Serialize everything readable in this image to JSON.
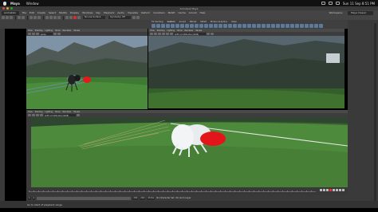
{
  "mac_menu": {
    "app_name": "Maya",
    "window": "Window",
    "clock": "Sun 11 Sep 8:51 PM"
  },
  "window_title": "Autodesk Maya",
  "menubar": {
    "mode": "Animation",
    "items": [
      "File",
      "Edit",
      "Create",
      "Select",
      "Modify",
      "Display",
      "Windows",
      "Key",
      "Playback",
      "Audio",
      "Visualize",
      "Deform",
      "Constrain",
      "MASH",
      "Cache",
      "Arnold",
      "Help"
    ],
    "workspace_label": "Workspace:",
    "workspace_value": "Maya Classic"
  },
  "statusline": {
    "no_live_surface": "No Live Surface",
    "symmetry": "Symmetry: Off"
  },
  "shelf": {
    "tabs": [
      "FX Caching",
      "Custom",
      "Arnold",
      "Bifrost",
      "MASH",
      "Motion Graphics",
      "XGen"
    ],
    "active_tab": "Custom"
  },
  "panel_top_left": {
    "menus": [
      "View",
      "Shading",
      "Lighting",
      "Show",
      "Renderer",
      "Panels"
    ],
    "field": "persp"
  },
  "panel_top_right": {
    "menus": [
      "View",
      "Shading",
      "Lighting",
      "Show",
      "Renderer",
      "Panels"
    ],
    "field": "ACES 1.0 SDR-video (sRGB)"
  },
  "panel_bottom": {
    "menus": [
      "View",
      "Shading",
      "Lighting",
      "Show",
      "Renderer",
      "Panels"
    ],
    "field": "ACES 1.0 SDR-video (sRGB)"
  },
  "timeline": {
    "range_start": "1",
    "playback_start": "1",
    "playback_end": "240",
    "range_end": "240",
    "fps": "24 fps",
    "no_character_set": "No Character Set",
    "no_anim_layer": "No Anim Layer"
  },
  "help_line": "Go to start of playback range"
}
